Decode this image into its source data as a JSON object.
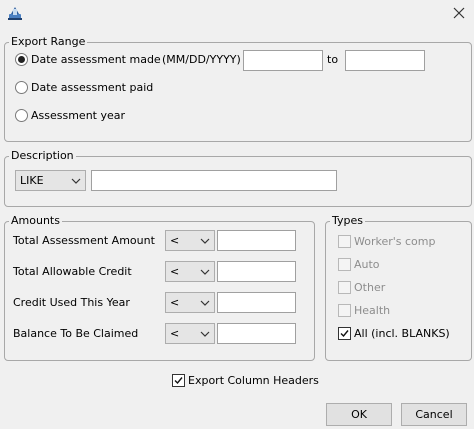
{
  "window": {
    "close_icon": "close-icon",
    "app_icon": "java-app-icon"
  },
  "export_range": {
    "legend": "Export Range",
    "options": [
      {
        "label": "Date assessment made",
        "selected": true
      },
      {
        "label": "Date assessment paid",
        "selected": false
      },
      {
        "label": "Assessment year",
        "selected": false
      }
    ],
    "date_format_hint": "(MM/DD/YYYY)",
    "from_value": "",
    "to_label": "to",
    "to_value": ""
  },
  "description": {
    "legend": "Description",
    "operator": "LIKE",
    "value": ""
  },
  "amounts": {
    "legend": "Amounts",
    "rows": [
      {
        "label": "Total Assessment Amount",
        "operator": "<",
        "value": ""
      },
      {
        "label": "Total Allowable Credit",
        "operator": "<",
        "value": ""
      },
      {
        "label": "Credit Used This Year",
        "operator": "<",
        "value": ""
      },
      {
        "label": "Balance To Be Claimed",
        "operator": "<",
        "value": ""
      }
    ]
  },
  "types": {
    "legend": "Types",
    "items": [
      {
        "label": "Worker's comp",
        "checked": false,
        "enabled": false
      },
      {
        "label": "Auto",
        "checked": false,
        "enabled": false
      },
      {
        "label": "Other",
        "checked": false,
        "enabled": false
      },
      {
        "label": "Health",
        "checked": false,
        "enabled": false
      },
      {
        "label": "All (incl. BLANKS)",
        "checked": true,
        "enabled": true
      }
    ]
  },
  "export_column_headers": {
    "label": "Export Column Headers",
    "checked": true
  },
  "buttons": {
    "ok": "OK",
    "cancel": "Cancel"
  }
}
